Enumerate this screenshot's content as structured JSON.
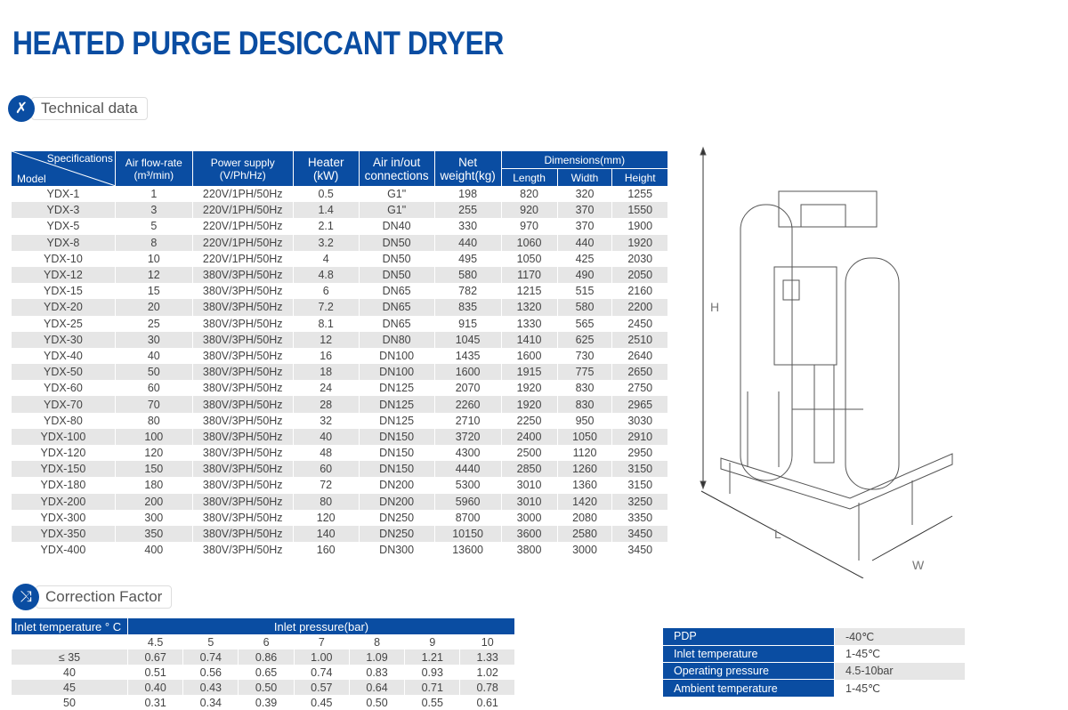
{
  "title": "HEATED PURGE DESICCANT DRYER",
  "tech_section": {
    "label": "Technical data",
    "icon": "wrench-screwdriver-icon"
  },
  "tech_table": {
    "corner_top": "Specifications",
    "corner_bottom": "Model",
    "headers": {
      "flow1": "Air flow-rate",
      "flow2": "(m³/min)",
      "power1": "Power supply",
      "power2": "(V/Ph/Hz)",
      "heater1": "Heater",
      "heater2": "(kW)",
      "air1": "Air in/out",
      "air2": "connections",
      "weight1": "Net",
      "weight2": "weight(kg)",
      "dims": "Dimensions(mm)",
      "length": "Length",
      "width": "Width",
      "height": "Height"
    },
    "rows": [
      [
        "YDX-1",
        "1",
        "220V/1PH/50Hz",
        "0.5",
        "G1\"",
        "198",
        "820",
        "320",
        "1255"
      ],
      [
        "YDX-3",
        "3",
        "220V/1PH/50Hz",
        "1.4",
        "G1\"",
        "255",
        "920",
        "370",
        "1550"
      ],
      [
        "YDX-5",
        "5",
        "220V/1PH/50Hz",
        "2.1",
        "DN40",
        "330",
        "970",
        "370",
        "1900"
      ],
      [
        "YDX-8",
        "8",
        "220V/1PH/50Hz",
        "3.2",
        "DN50",
        "440",
        "1060",
        "440",
        "1920"
      ],
      [
        "YDX-10",
        "10",
        "220V/1PH/50Hz",
        "4",
        "DN50",
        "495",
        "1050",
        "425",
        "2030"
      ],
      [
        "YDX-12",
        "12",
        "380V/3PH/50Hz",
        "4.8",
        "DN50",
        "580",
        "1170",
        "490",
        "2050"
      ],
      [
        "YDX-15",
        "15",
        "380V/3PH/50Hz",
        "6",
        "DN65",
        "782",
        "1215",
        "515",
        "2160"
      ],
      [
        "YDX-20",
        "20",
        "380V/3PH/50Hz",
        "7.2",
        "DN65",
        "835",
        "1320",
        "580",
        "2200"
      ],
      [
        "YDX-25",
        "25",
        "380V/3PH/50Hz",
        "8.1",
        "DN65",
        "915",
        "1330",
        "565",
        "2450"
      ],
      [
        "YDX-30",
        "30",
        "380V/3PH/50Hz",
        "12",
        "DN80",
        "1045",
        "1410",
        "625",
        "2510"
      ],
      [
        "YDX-40",
        "40",
        "380V/3PH/50Hz",
        "16",
        "DN100",
        "1435",
        "1600",
        "730",
        "2640"
      ],
      [
        "YDX-50",
        "50",
        "380V/3PH/50Hz",
        "18",
        "DN100",
        "1600",
        "1915",
        "775",
        "2650"
      ],
      [
        "YDX-60",
        "60",
        "380V/3PH/50Hz",
        "24",
        "DN125",
        "2070",
        "1920",
        "830",
        "2750"
      ],
      [
        "YDX-70",
        "70",
        "380V/3PH/50Hz",
        "28",
        "DN125",
        "2260",
        "1920",
        "830",
        "2965"
      ],
      [
        "YDX-80",
        "80",
        "380V/3PH/50Hz",
        "32",
        "DN125",
        "2710",
        "2250",
        "950",
        "3030"
      ],
      [
        "YDX-100",
        "100",
        "380V/3PH/50Hz",
        "40",
        "DN150",
        "3720",
        "2400",
        "1050",
        "2910"
      ],
      [
        "YDX-120",
        "120",
        "380V/3PH/50Hz",
        "48",
        "DN150",
        "4300",
        "2500",
        "1120",
        "2950"
      ],
      [
        "YDX-150",
        "150",
        "380V/3PH/50Hz",
        "60",
        "DN150",
        "4440",
        "2850",
        "1260",
        "3150"
      ],
      [
        "YDX-180",
        "180",
        "380V/3PH/50Hz",
        "72",
        "DN200",
        "5300",
        "3010",
        "1360",
        "3150"
      ],
      [
        "YDX-200",
        "200",
        "380V/3PH/50Hz",
        "80",
        "DN200",
        "5960",
        "3010",
        "1420",
        "3250"
      ],
      [
        "YDX-300",
        "300",
        "380V/3PH/50Hz",
        "120",
        "DN250",
        "8700",
        "3000",
        "2080",
        "3350"
      ],
      [
        "YDX-350",
        "350",
        "380V/3PH/50Hz",
        "140",
        "DN250",
        "10150",
        "3600",
        "2580",
        "3450"
      ],
      [
        "YDX-400",
        "400",
        "380V/3PH/50Hz",
        "160",
        "DN300",
        "13600",
        "3800",
        "3000",
        "3450"
      ]
    ]
  },
  "corr_section": {
    "label": "Correction Factor",
    "icon": "shuffle-arrows-icon"
  },
  "corr_table": {
    "row_header": "Inlet temperature ° C",
    "col_header": "Inlet pressure(bar)",
    "pressures": [
      "4.5",
      "5",
      "6",
      "7",
      "8",
      "9",
      "10"
    ],
    "rows": [
      [
        "≤ 35",
        "0.67",
        "0.74",
        "0.86",
        "1.00",
        "1.09",
        "1.21",
        "1.33"
      ],
      [
        "40",
        "0.51",
        "0.56",
        "0.65",
        "0.74",
        "0.83",
        "0.93",
        "1.02"
      ],
      [
        "45",
        "0.40",
        "0.43",
        "0.50",
        "0.57",
        "0.64",
        "0.71",
        "0.78"
      ],
      [
        "50",
        "0.31",
        "0.34",
        "0.39",
        "0.45",
        "0.50",
        "0.55",
        "0.61"
      ]
    ]
  },
  "conditions": [
    {
      "label": "PDP",
      "value": "-40℃"
    },
    {
      "label": "Inlet temperature",
      "value": "1-45℃"
    },
    {
      "label": "Operating pressure",
      "value": "4.5-10bar"
    },
    {
      "label": "Ambient temperature",
      "value": "1-45℃"
    }
  ],
  "drawing": {
    "dim_h": "H",
    "dim_l": "L",
    "dim_w": "W"
  },
  "colors": {
    "brand": "#0a4da2",
    "row_alt": "#e6e6e6"
  }
}
